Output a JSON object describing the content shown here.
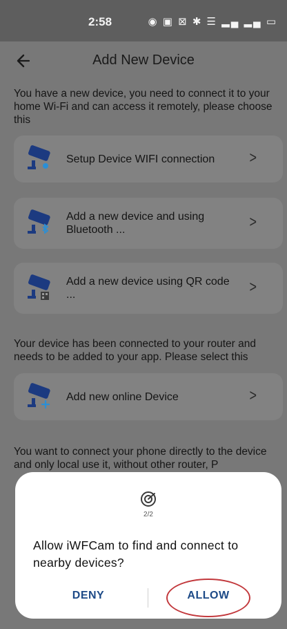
{
  "status_bar": {
    "time": "2:58",
    "icons_text": "◉ ▣ ⊠ ✱ ☰ ▂▄ ▂▄ ▭"
  },
  "header": {
    "title": "Add New Device"
  },
  "sections": {
    "new_device_text": "You have a new device, you need to connect it to your home Wi-Fi and can access it remotely, please choose this",
    "router_text": "Your device has been connected to your router and needs to be added to your app. Please select this",
    "direct_text": "You want to connect your phone directly to the device and only local use it, without other router, P"
  },
  "options": {
    "wifi_setup": "Setup Device WIFI connection",
    "bluetooth": "Add a new device and using Bluetooth ...",
    "qr_code": "Add a new device using QR code ...",
    "online_device": "Add new online Device",
    "chevron": ">"
  },
  "dialog": {
    "step": "2/2",
    "message": "Allow iWFCam to find and connect to nearby devices?",
    "deny_label": "DENY",
    "allow_label": "ALLOW"
  },
  "colors": {
    "dim_background": "#787878",
    "card": "#828282",
    "icon_blue": "#1c3a80",
    "button_text": "#1d4a87",
    "highlight_circle": "#c2383c"
  }
}
